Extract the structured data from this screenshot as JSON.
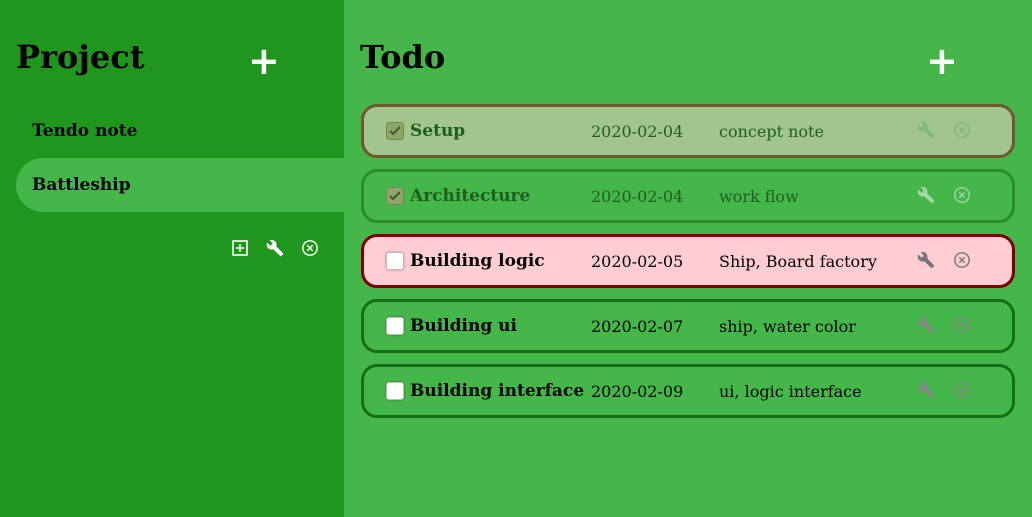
{
  "sidebar": {
    "title": "Project",
    "add_label": "+",
    "projects": [
      {
        "name": "Tendo note",
        "active": false
      },
      {
        "name": "Battleship",
        "active": true
      }
    ],
    "tools": [
      "add-box-icon",
      "wrench-icon",
      "close-circle-icon"
    ]
  },
  "main": {
    "title": "Todo",
    "add_label": "+",
    "todos": [
      {
        "title": "Setup",
        "date": "2020-02-04",
        "tags": "concept note",
        "done": true
      },
      {
        "title": "Architecture",
        "date": "2020-02-04",
        "tags": "work flow",
        "done": true
      },
      {
        "title": "Building logic",
        "date": "2020-02-05",
        "tags": "Ship, Board factory",
        "done": false
      },
      {
        "title": "Building ui",
        "date": "2020-02-07",
        "tags": "ship, water color",
        "done": false
      },
      {
        "title": "Building interface",
        "date": "2020-02-09",
        "tags": "ui, logic interface",
        "done": false
      }
    ]
  },
  "colors": {
    "sidebar_bg": "#20961f",
    "main_bg": "#45b649",
    "done_highlight_bg": "#a2c48f",
    "alert_bg": "#ffcdd2",
    "alert_border": "#7a0000",
    "item_border": "#166e16"
  }
}
